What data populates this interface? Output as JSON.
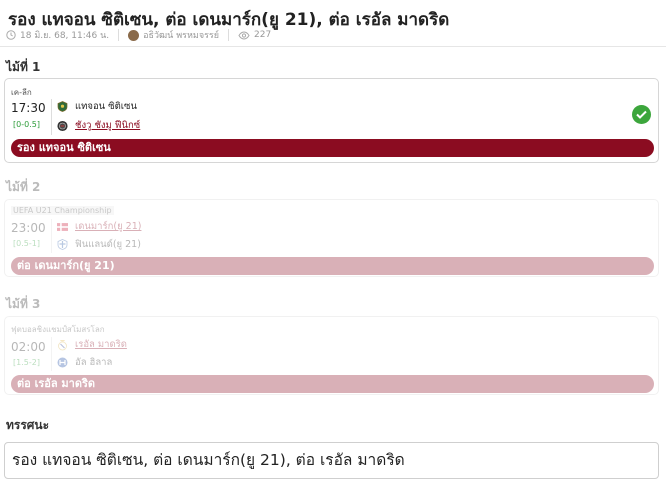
{
  "header": {
    "title": "รอง แทจอน ซิติเซน, ต่อ เดนมาร์ก(ยู 21), ต่อ เรอัล มาดริด",
    "date": "18 มิ.ย. 68, 11:46 น.",
    "author": "อธิวัฒน์ พรหมจรรย์",
    "views": "227"
  },
  "picks": [
    {
      "label": "ไม้ที่ 1",
      "league": "เค-ลีก",
      "time": "17:30",
      "handicap": "[0-0.5]",
      "home_team": "แทจอน ซิติเซน",
      "away_team": "ชังวู ชังมู ฟีนิกซ์",
      "result_icon": "check-icon",
      "selection": "รอง แทจอน ซิติเซน"
    },
    {
      "label": "ไม้ที่ 2",
      "league": "UEFA U21 Championship",
      "time": "23:00",
      "handicap": "[0.5-1]",
      "home_team": "เดนมาร์ก(ยู 21)",
      "away_team": "ฟินแลนด์(ยู 21)",
      "selection": "ต่อ เดนมาร์ก(ยู 21)"
    },
    {
      "label": "ไม้ที่ 3",
      "league": "ฟุตบอลชิงแชมป์สโมสรโลก",
      "time": "02:00",
      "handicap": "[1.5-2]",
      "home_team": "เรอัล มาดริด",
      "away_team": "อัล ฮิลาล",
      "selection": "ต่อ เรอัล มาดริด"
    }
  ],
  "verdict": {
    "label": "ทรรศนะ",
    "text": "รอง แทจอน ซิติเซน, ต่อ เดนมาร์ก(ยู 21), ต่อ เรอัล มาดริด"
  },
  "colors": {
    "accent": "#8b0c21",
    "success": "#3ca63c",
    "handicap": "#2e9c3a"
  }
}
